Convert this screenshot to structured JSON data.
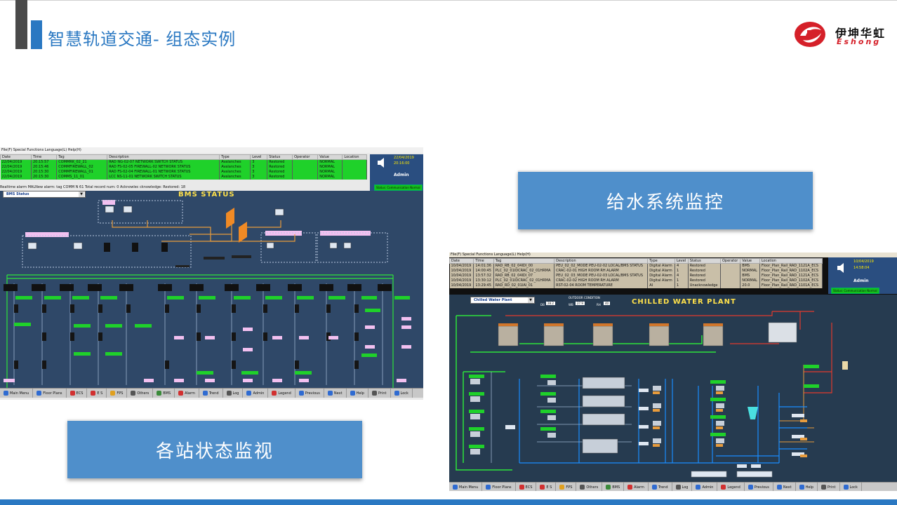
{
  "slide": {
    "title": "智慧轨道交通- 组态实例",
    "logo_cn": "伊坤华虹",
    "logo_en": "Eshong"
  },
  "captions": {
    "water": "给水系统监控",
    "stations": "各站状态监视"
  },
  "colors": {
    "accent": "#2a78c2",
    "caption_bg": "#4f8fcb",
    "alarm_restored": "#1fd12a",
    "scada_bg": "#2f4868",
    "brand_red": "#d52029"
  },
  "bms": {
    "menu": "File(F)  Special Functions  Language(L)  Help(H)",
    "columns": [
      "Date",
      "Time",
      "Tag",
      "Description",
      "Type",
      "Level",
      "Status",
      "Operator",
      "Value",
      "Location"
    ],
    "rows": [
      [
        "22/04/2019",
        "20:15:57",
        "COMMRK_02_21",
        "RAD NG-02-07 NETWORK SWITCH STATUS",
        "Avalanches",
        "3",
        "Restored",
        "",
        "NORMAL",
        ""
      ],
      [
        "22/04/2019",
        "20:15:46",
        "COMMFIREWALL_02",
        "RAD FS-02-05 FIREWALL-02 NETWORK STATUS",
        "Avalanches",
        "3",
        "Restored",
        "",
        "NORMAL",
        ""
      ],
      [
        "22/04/2019",
        "20:15:30",
        "COMMFIREWALL_01",
        "RAD FS-02-04 FIREWALL-01 NETWORK STATUS",
        "Avalanches",
        "3",
        "Restored",
        "",
        "NORMAL",
        ""
      ],
      [
        "22/04/2019",
        "20:15:30",
        "COMMS_11_01",
        "LCC NS-11-01 NETWORK SWITCH STATUS",
        "Avalanches",
        "3",
        "Restored",
        "",
        "NORMAL",
        ""
      ]
    ],
    "status_line": "Realtime alarm    MALNew alarm: tag COMM N 61 Total record num: 0 Acknowlec cknowledge: Restored: 18",
    "side_date": "22/04/2019",
    "side_time": "20:16:00",
    "side_admin": "Admin",
    "side_button": "Status: Communication Normal",
    "dropdown": "BMS Status",
    "title": "BMS STATUS",
    "nav": [
      "Main Menu",
      "Floor Plans",
      "ECS",
      "E S",
      "FPS",
      "Others",
      "BMS",
      "Alarm",
      "Trend",
      "Log",
      "Admin",
      "Legend",
      "Previous",
      "Next",
      "Help",
      "Print",
      "Lock"
    ]
  },
  "chw": {
    "menu": "File(F)  Special Functions  Language(L)  Help(H)",
    "columns": [
      "Date",
      "Time",
      "Tag",
      "Description",
      "Type",
      "Level",
      "Status",
      "Operator",
      "Value",
      "Location"
    ],
    "rows": [
      [
        "10/04/2019",
        "14:01:36",
        "RAD_RB_02_04IDI_00",
        "PEU_02_02_MODE PEU-02-02 LOCAL/BMS STATUS",
        "Digital Alarm",
        "4",
        "Restored",
        "",
        "BMS",
        "Floor_Plan_Rail_RAD_1121A_ECS"
      ],
      [
        "10/04/2019",
        "14:00:45",
        "PLC_02_01IDCRAC_02_01HRMA",
        "CRAC-02-01 HIGH ROOM RH ALARM",
        "Digital Alarm",
        "1",
        "Restored",
        "",
        "NORMAL",
        "Floor_Plan_Rail_RAD_1102A_ECS"
      ],
      [
        "10/04/2019",
        "13:57:32",
        "RAD_RB_02_04IDI_07",
        "PEU_02_03_MODE PEU-02-03 LOCAL/BMS STATUS",
        "Digital Alarm",
        "4",
        "Restored",
        "",
        "BMS",
        "Floor_Plan_Rail_RAD_1121A_ECS"
      ],
      [
        "10/04/2019",
        "13:30:12",
        "PLC_02_01IDCRAC_02_01HRMA",
        "CRAC-02-02 HIGH ROOM RH ALARM",
        "Digital Alarm",
        "1",
        "Restored",
        "",
        "NORMAL",
        "Floor_Plan_Rail_RAD_1102A_ECS"
      ],
      [
        "10/04/2019",
        "13:29:45",
        "RAD_RD_02_01IAI_01",
        "RST-02-04 ROOM TEMPERATURE",
        "AI",
        "1",
        "Unacknowledge",
        "",
        "20.0",
        "Floor_Plan_Rail_RAD_1101A_ECS"
      ]
    ],
    "side_date": "10/04/2019",
    "side_time": "14:58:04",
    "side_admin": "Admin",
    "side_button": "Status: Communication Normal",
    "dropdown": "Chilled Water Plant",
    "outdoor_label": "OUTDOOR CONDITION",
    "db_label": "DB",
    "db_value": "28.2",
    "wb_label": "WB",
    "wb_value": "27.9",
    "rh_label": "RH",
    "rh_value": "40",
    "title": "CHILLED WATER PLANT",
    "nav": [
      "Main Menu",
      "Floor Plans",
      "ECS",
      "E S",
      "FPS",
      "Others",
      "BMS",
      "Alarm",
      "Trend",
      "Log",
      "Admin",
      "Legend",
      "Previous",
      "Next",
      "Help",
      "Print",
      "Lock"
    ]
  }
}
